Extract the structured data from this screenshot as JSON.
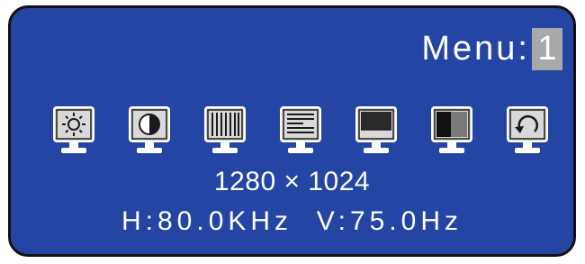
{
  "menu": {
    "label": "Menu:",
    "number": "1"
  },
  "icons": [
    {
      "name": "brightness-icon",
      "tooltip": ""
    },
    {
      "name": "contrast-icon",
      "tooltip": ""
    },
    {
      "name": "h-position-icon",
      "tooltip": ""
    },
    {
      "name": "v-position-icon",
      "tooltip": ""
    },
    {
      "name": "h-size-icon",
      "tooltip": ""
    },
    {
      "name": "v-size-icon",
      "tooltip": ""
    },
    {
      "name": "recall-icon",
      "tooltip": ""
    }
  ],
  "status": {
    "resolution": "1280 × 1024",
    "frequency": "H:80.0KHz  V:75.0Hz"
  },
  "colors": {
    "background": "#2445a3",
    "border": "#111111",
    "text": "#ffffff",
    "highlight": "#a9a9a9"
  }
}
